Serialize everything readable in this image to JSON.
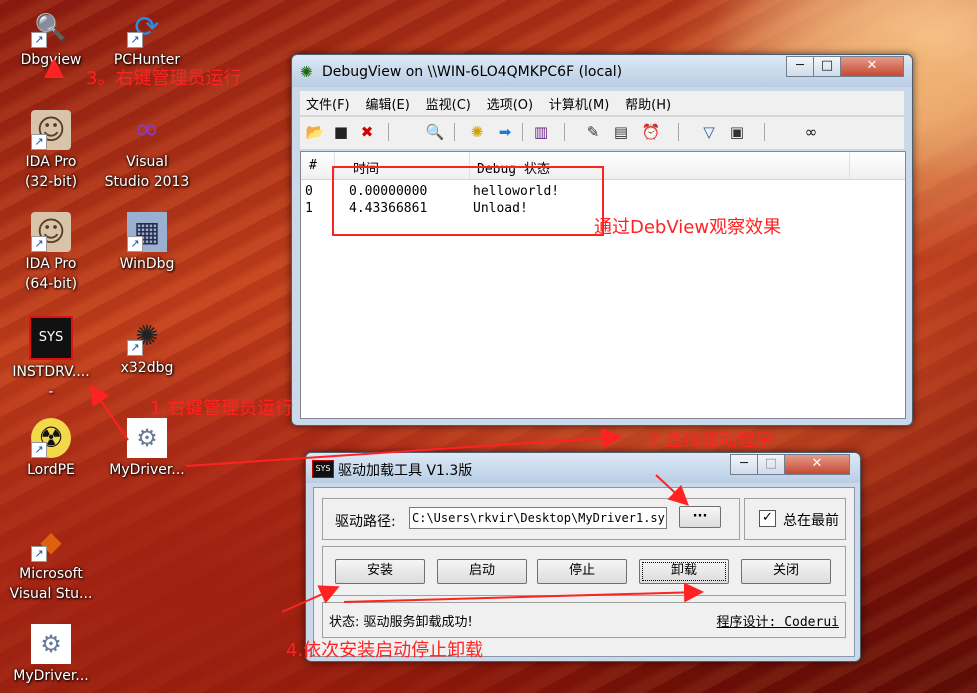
{
  "desktop_icons": [
    {
      "name": "desktop-icon-dbgview",
      "label": "Dbgview",
      "glyph": "🔍"
    },
    {
      "name": "desktop-icon-pchunter",
      "label": "PCHunter",
      "glyph": "⟳"
    },
    {
      "name": "desktop-icon-ida32",
      "label": "IDA Pro\n(32-bit)",
      "glyph": "☺"
    },
    {
      "name": "desktop-icon-vs2013",
      "label": "Visual\nStudio 2013",
      "glyph": "∞"
    },
    {
      "name": "desktop-icon-ida64",
      "label": "IDA Pro\n(64-bit)",
      "glyph": "☺"
    },
    {
      "name": "desktop-icon-windbg",
      "label": "WinDbg",
      "glyph": "▦"
    },
    {
      "name": "desktop-icon-instdrv",
      "label": "INSTDRV....\n-",
      "glyph": "SYS"
    },
    {
      "name": "desktop-icon-x32dbg",
      "label": "x32dbg",
      "glyph": "✺"
    },
    {
      "name": "desktop-icon-lordpe",
      "label": "LordPE",
      "glyph": "☢"
    },
    {
      "name": "desktop-icon-mydriver1",
      "label": "MyDriver...",
      "glyph": "⚙"
    },
    {
      "name": "desktop-icon-msvs",
      "label": "Microsoft\nVisual Stu...",
      "glyph": "◆"
    },
    {
      "name": "desktop-icon-mydriver2",
      "label": "MyDriver...",
      "glyph": "⚙"
    }
  ],
  "debugview": {
    "title": "DebugView on \\\\WIN-6LO4QMKPC6F (local)",
    "menu": [
      "文件(F)",
      "编辑(E)",
      "监视(C)",
      "选项(O)",
      "计算机(M)",
      "帮助(H)"
    ],
    "columns": [
      "#",
      "时间",
      "Debug 状态"
    ],
    "rows": [
      {
        "num": "0",
        "time": "0.00000000",
        "msg": "helloworld!"
      },
      {
        "num": "1",
        "time": "4.43366861",
        "msg": "Unload!"
      }
    ],
    "toolbar_icons": [
      "open-icon",
      "save-icon",
      "clear-icon",
      "find-icon",
      "capture-icon",
      "autoscroll-icon",
      "highlight-icon",
      "filter-icon",
      "history-icon",
      "clock-icon",
      "pin-icon",
      "options-icon",
      "binoculars-icon"
    ]
  },
  "loader": {
    "title": "驱动加载工具 V1.3版",
    "icon_text": "SYS",
    "path_label": "驱动路径:",
    "path_value": "C:\\Users\\rkvir\\Desktop\\MyDriver1.sys",
    "browse_label": "···",
    "topmost_label": "总在最前",
    "topmost_checked": true,
    "buttons": [
      "安装",
      "启动",
      "停止",
      "卸载",
      "关闭"
    ],
    "status": "状态: 驱动服务卸载成功!",
    "credit": "程序设计: Coderui"
  },
  "annotations": {
    "a1": "1.右键管理员运行",
    "a2": "2.查找驱动程序",
    "a3": "3。右键管理员运行",
    "a4": "4.依次安装启动停止卸载",
    "a5": "通过DebView观察效果"
  },
  "colors": {
    "annotation": "#ff2222",
    "title_bar": "#c9d9ea",
    "close_button": "#c44a32"
  }
}
